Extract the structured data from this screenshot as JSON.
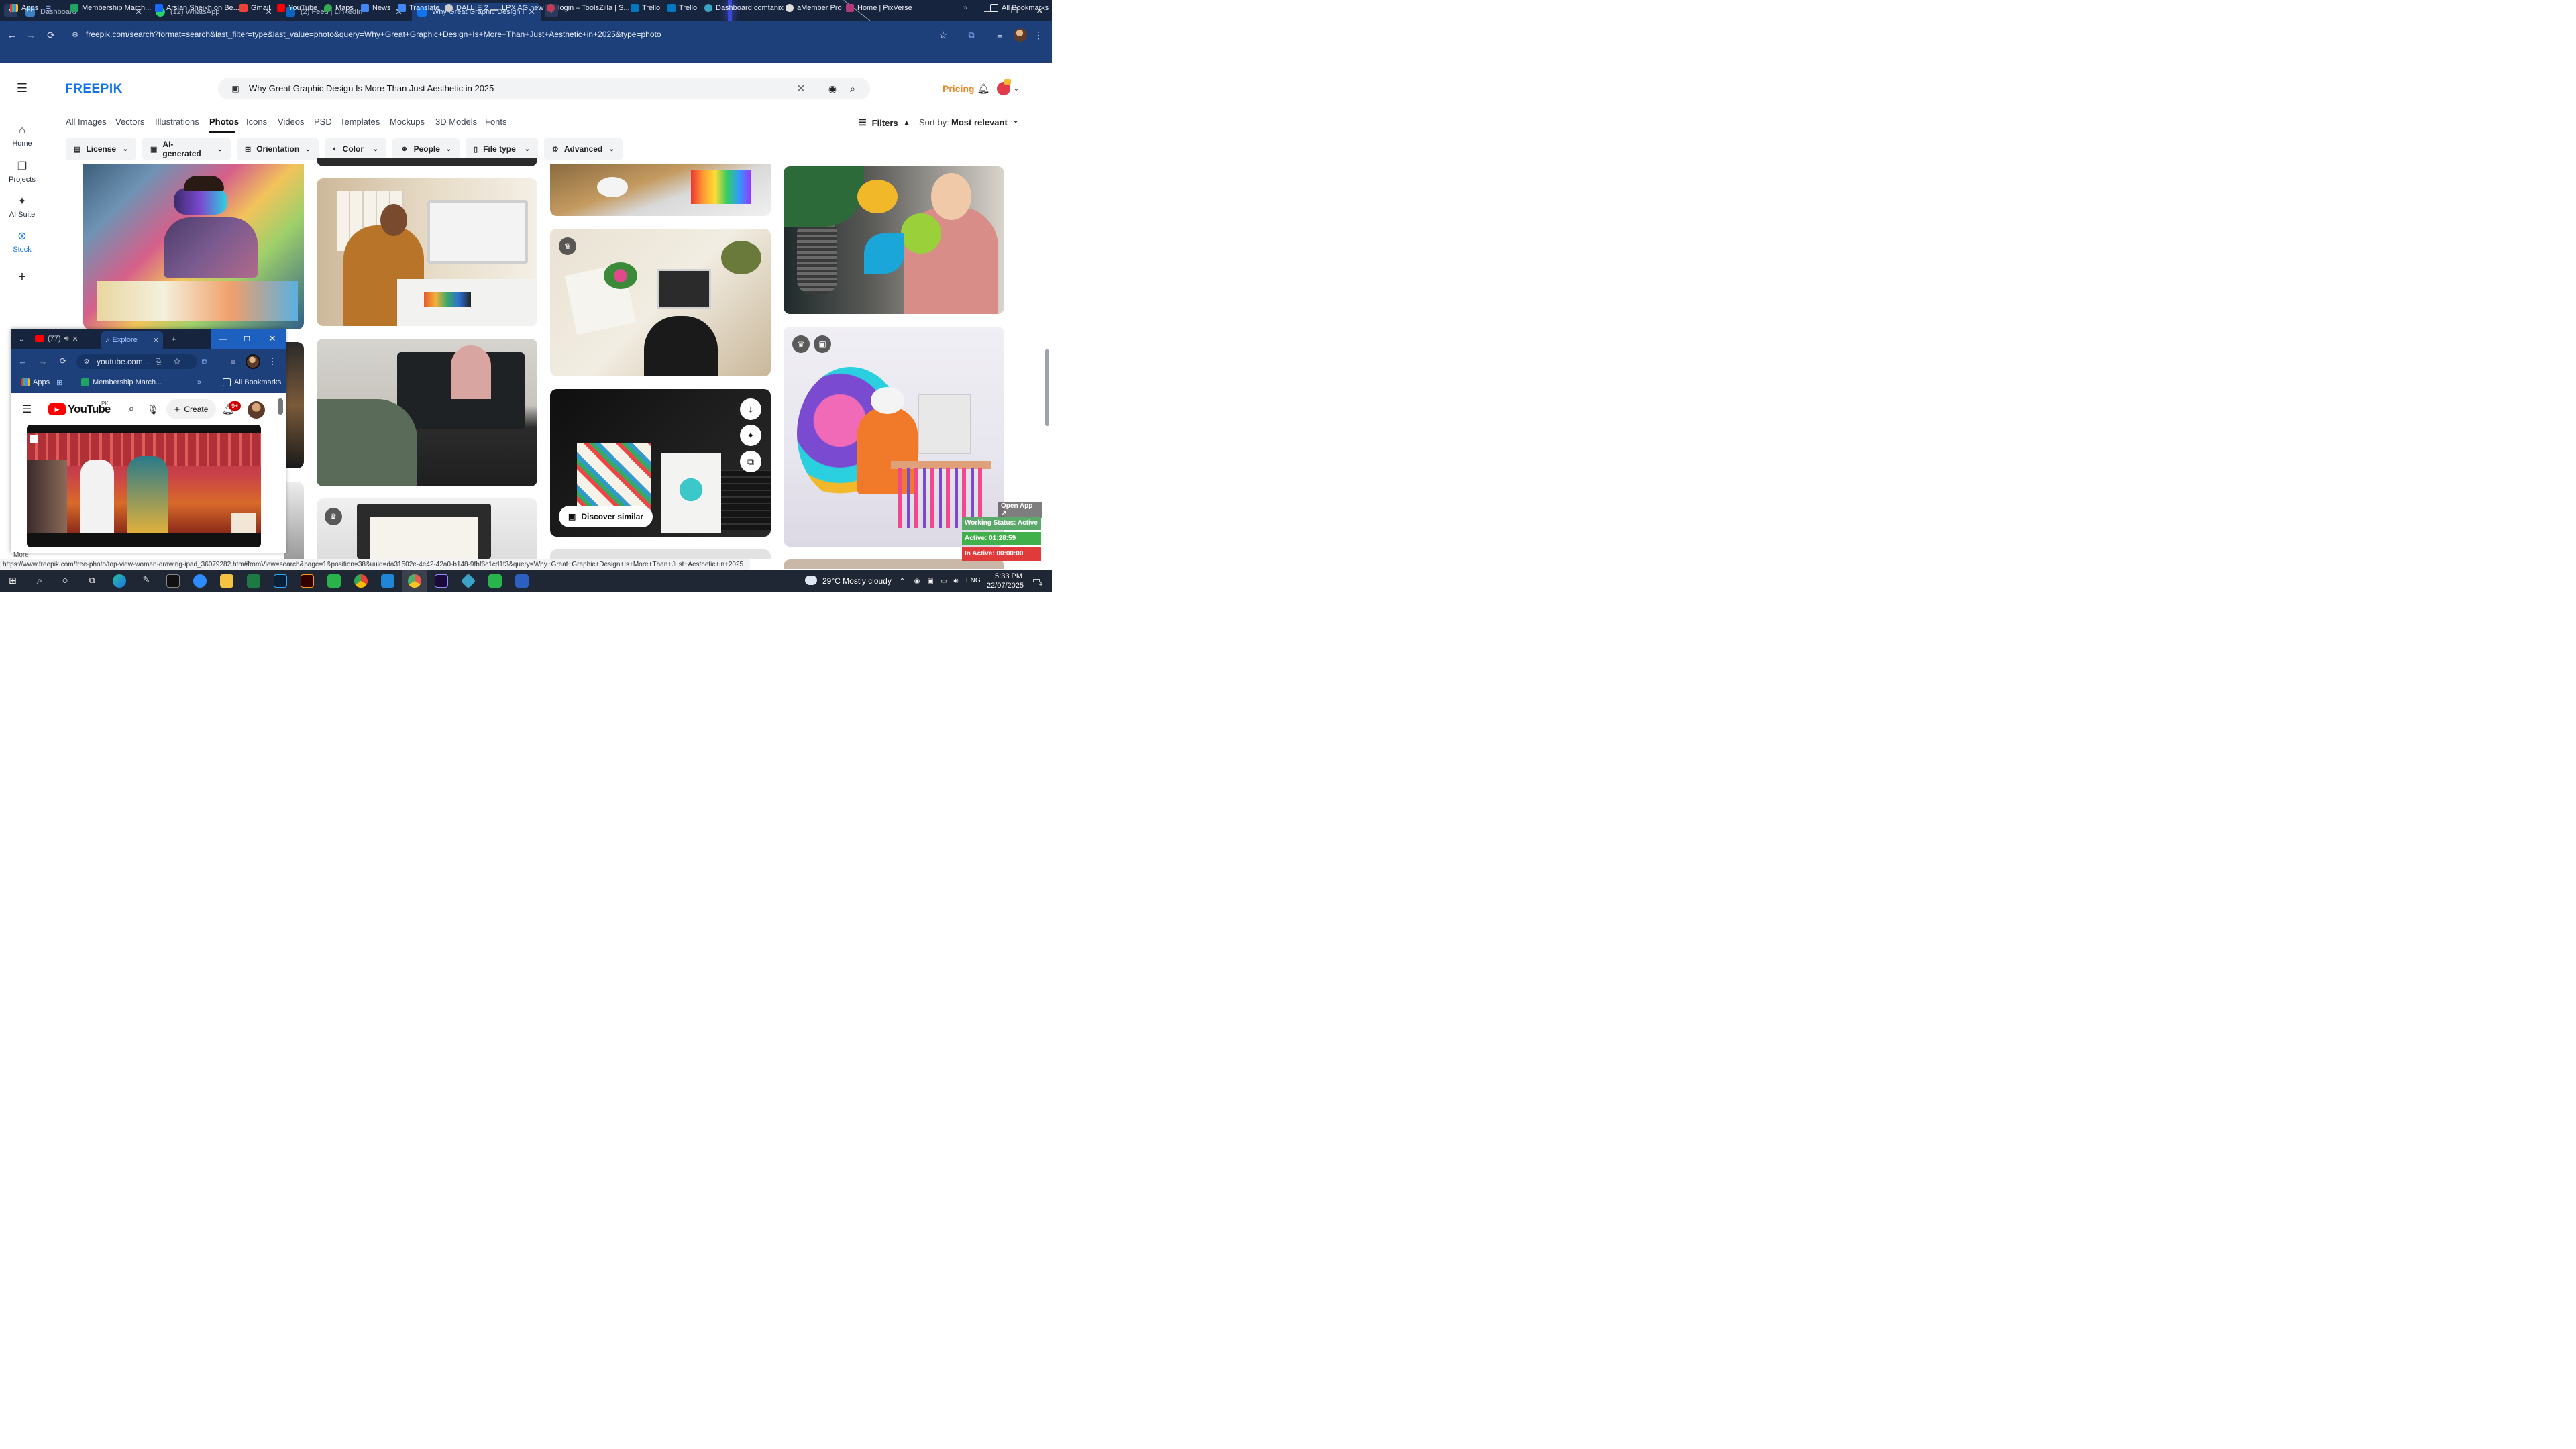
{
  "browser": {
    "tabs": [
      {
        "title": "Dashboard",
        "color": "#3b82c4"
      },
      {
        "title": "(12) WhatsApp",
        "color": "#25d366"
      },
      {
        "title": "(2) Feed | LinkedIn",
        "color": "#0a66c2"
      },
      {
        "title": "Why Great Graphic Design Is M",
        "color": "#1273eb"
      }
    ],
    "url": "freepik.com/search?format=search&last_filter=type&last_value=photo&query=Why+Great+Graphic+Design+Is+More+Than+Just+Aesthetic+in+2025&type=photo",
    "bookmarks": [
      "Apps",
      "Membership March...",
      "Arslan Sheikh on Be...",
      "Gmail",
      "YouTube",
      "Maps",
      "News",
      "Translate",
      "DALL·E 2",
      "LPX AG new",
      "login – ToolsZilla | S...",
      "Trello",
      "Trello",
      "Dashboard comtanix",
      "aMember Pro",
      "Home | PixVerse"
    ],
    "all_bookmarks": "All Bookmarks"
  },
  "freepik": {
    "logo": "FREEPIK",
    "search_query": "Why Great Graphic Design Is More Than Just Aesthetic in 2025",
    "pricing": "Pricing",
    "rail": [
      "Home",
      "Projects",
      "AI Suite",
      "Stock"
    ],
    "nav_tabs": [
      "All Images",
      "Vectors",
      "Illustrations",
      "Photos",
      "Icons",
      "Videos",
      "PSD",
      "Templates",
      "Mockups",
      "3D Models",
      "Fonts"
    ],
    "active_tab": "Photos",
    "filters_label": "Filters",
    "sort_label": "Sort by:",
    "sort_value": "Most relevant",
    "chips": [
      "License",
      "AI-generated",
      "Orientation",
      "Color",
      "People",
      "File type",
      "Advanced"
    ],
    "discover_similar": "Discover similar"
  },
  "mini_window": {
    "tabs": [
      "(77)",
      "Explore"
    ],
    "url": "youtube.com...",
    "bookmarks": [
      "Apps",
      "Membership March..."
    ],
    "all_bookmarks": "All Bookmarks",
    "yt_logo": "YouTube",
    "yt_region": "PK",
    "create": "Create",
    "notif_count": "9+",
    "more": "More"
  },
  "status_url": "https://www.freepik.com/free-photo/top-view-woman-drawing-ipad_36079282.htm#fromView=search&page=1&position=38&uuid=da31502e-4e42-42a0-b148-9fbf6c1cd1f3&query=Why+Great+Graphic+Design+Is+More+Than+Just+Aesthetic+in+2025",
  "working_status": {
    "open_app": "Open App ↗",
    "status": "Working Status: Active",
    "active": "Active: 01:28:59",
    "inactive": "In Active: 00:00:00"
  },
  "taskbar": {
    "weather": "29°C  Mostly cloudy",
    "lang": "ENG",
    "time": "5:33 PM",
    "date": "22/07/2025",
    "notif": "4"
  }
}
